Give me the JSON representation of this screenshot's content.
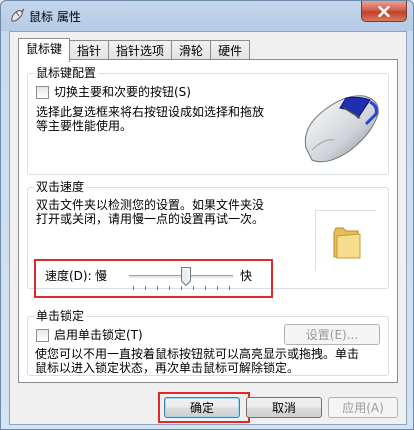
{
  "window": {
    "title": "鼠标 属性",
    "close_label": "×"
  },
  "tabs": [
    {
      "label": "鼠标键",
      "active": true
    },
    {
      "label": "指针",
      "active": false
    },
    {
      "label": "指针选项",
      "active": false
    },
    {
      "label": "滑轮",
      "active": false
    },
    {
      "label": "硬件",
      "active": false
    }
  ],
  "button_config": {
    "title": "鼠标键配置",
    "switch_checkbox_label": "切换主要和次要的按钮(S)",
    "switch_checked": false,
    "description_line1": "选择此复选框来将右按钮设成如选择和拖放",
    "description_line2": "等主要性能使用。"
  },
  "double_click": {
    "title": "双击速度",
    "description_line1": "双击文件夹以检测您的设置。如果文件夹没",
    "description_line2": "打开或关闭，请用慢一点的设置再试一次。",
    "speed_label": "速度(D):",
    "slow_label": "慢",
    "fast_label": "快",
    "speed_level_fraction": 0.5
  },
  "click_lock": {
    "title": "单击锁定",
    "enable_checkbox_label": "启用单击锁定(T)",
    "enable_checked": false,
    "settings_button": "设置(E)...",
    "description_line1": "使您可以不用一直按着鼠标按钮就可以高亮显示或拖拽。单击",
    "description_line2": "鼠标以进入锁定状态，再次单击鼠标可解除锁定。"
  },
  "footer": {
    "ok_label": "确定",
    "cancel_label": "取消",
    "apply_label": "应用(A)"
  },
  "colors": {
    "highlight": "#e02a2a",
    "folder": "#f3d27a"
  }
}
